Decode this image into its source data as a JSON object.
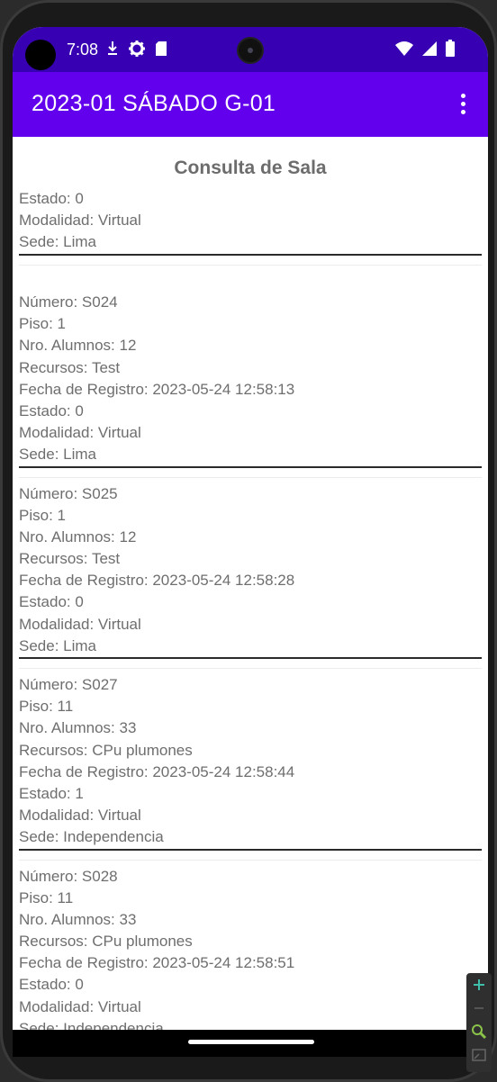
{
  "status_bar": {
    "time": "7:08"
  },
  "app_bar": {
    "title": "2023-01 SÁBADO G-01"
  },
  "page": {
    "title": "Consulta de Sala"
  },
  "first_card": {
    "estado": "Estado: 0",
    "modalidad": "Modalidad: Virtual",
    "sede": "Sede: Lima"
  },
  "cards": [
    {
      "numero": "Número: S024",
      "piso": "Piso: 1",
      "alumnos": "Nro. Alumnos: 12",
      "recursos": "Recursos: Test",
      "fecha": "Fecha de Registro: 2023-05-24 12:58:13",
      "estado": "Estado: 0",
      "modalidad": "Modalidad: Virtual",
      "sede": "Sede: Lima"
    },
    {
      "numero": "Número: S025",
      "piso": "Piso: 1",
      "alumnos": "Nro. Alumnos: 12",
      "recursos": "Recursos: Test",
      "fecha": "Fecha de Registro: 2023-05-24 12:58:28",
      "estado": "Estado: 0",
      "modalidad": "Modalidad: Virtual",
      "sede": "Sede: Lima"
    },
    {
      "numero": "Número: S027",
      "piso": "Piso: 11",
      "alumnos": "Nro. Alumnos: 33",
      "recursos": "Recursos: CPu plumones",
      "fecha": "Fecha de Registro: 2023-05-24 12:58:44",
      "estado": "Estado: 1",
      "modalidad": "Modalidad: Virtual",
      "sede": "Sede: Independencia"
    },
    {
      "numero": "Número: S028",
      "piso": "Piso: 11",
      "alumnos": "Nro. Alumnos: 33",
      "recursos": "Recursos: CPu plumones",
      "fecha": "Fecha de Registro: 2023-05-24 12:58:51",
      "estado": "Estado: 0",
      "modalidad": "Modalidad: Virtual",
      "sede": "Sede: Independencia"
    }
  ],
  "colors": {
    "status_bar": "#3700b3",
    "app_bar": "#6200ee",
    "text": "#6e6e6e",
    "divider": "#2a2a2a"
  },
  "icons": {
    "status_left": [
      "download-icon",
      "settings-icon",
      "sd-card-icon"
    ],
    "status_right": [
      "wifi-icon",
      "signal-icon",
      "battery-icon"
    ],
    "app_bar": "more-vert-icon",
    "emulator": [
      "zoom-in-icon",
      "zoom-out-icon",
      "magnifier-icon",
      "screen-icon"
    ]
  }
}
